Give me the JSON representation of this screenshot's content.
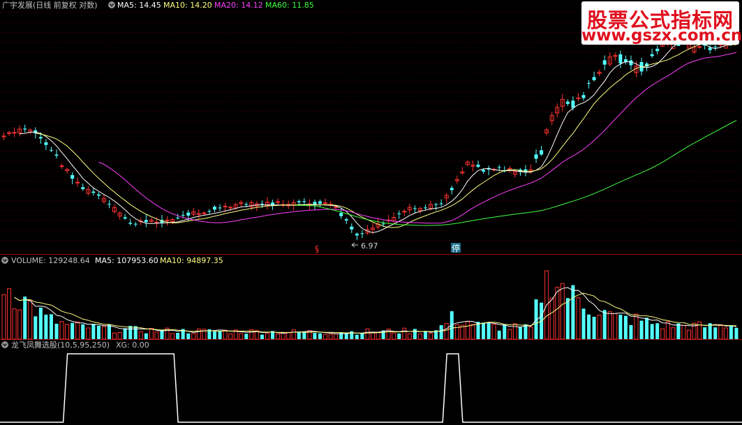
{
  "header": {
    "stock_title": "广宇发展(日线 前复权 对数)",
    "ma5": "MA5: 14.45",
    "ma10": "MA10: 14.20",
    "ma20": "MA20: 14.12",
    "ma60": "MA60: 11.85"
  },
  "volume_header": {
    "title": "VOLUME: 129248.64",
    "ma5": "MA5: 107953.60",
    "ma10": "MA10: 94897.35"
  },
  "indicator_header": {
    "title": "龙飞凤舞选股(10,5,95,250)",
    "xg": "XG: 0.00"
  },
  "annotations": {
    "low_price": "6.97",
    "mark_s": "§",
    "mark_stop": "停"
  },
  "watermark": {
    "line1": "股票公式指标网",
    "line2": "www.gszx.com.cn"
  },
  "colors": {
    "up": "#ff3232",
    "down": "#54ffff",
    "ma5": "#ffffff",
    "ma10": "#ffff80",
    "ma20": "#ff40ff",
    "ma60": "#40ff40",
    "divider": "#a00000",
    "grid": "#5a0000"
  },
  "chart_data": {
    "type": "candlestick",
    "price_ma_values": {
      "ma5": 14.45,
      "ma10": 14.2,
      "ma20": 14.12,
      "ma60": 11.85
    },
    "period_low": 6.97,
    "volume": {
      "latest": 129248.64,
      "ma5": 107953.6,
      "ma10": 94897.35
    },
    "indicator": {
      "name": "龙飞凤舞选股",
      "params": [
        10,
        5,
        95,
        250
      ],
      "xg": 0.0,
      "signal_intervals": [
        [
          12,
          33
        ],
        [
          84,
          87
        ]
      ]
    }
  }
}
